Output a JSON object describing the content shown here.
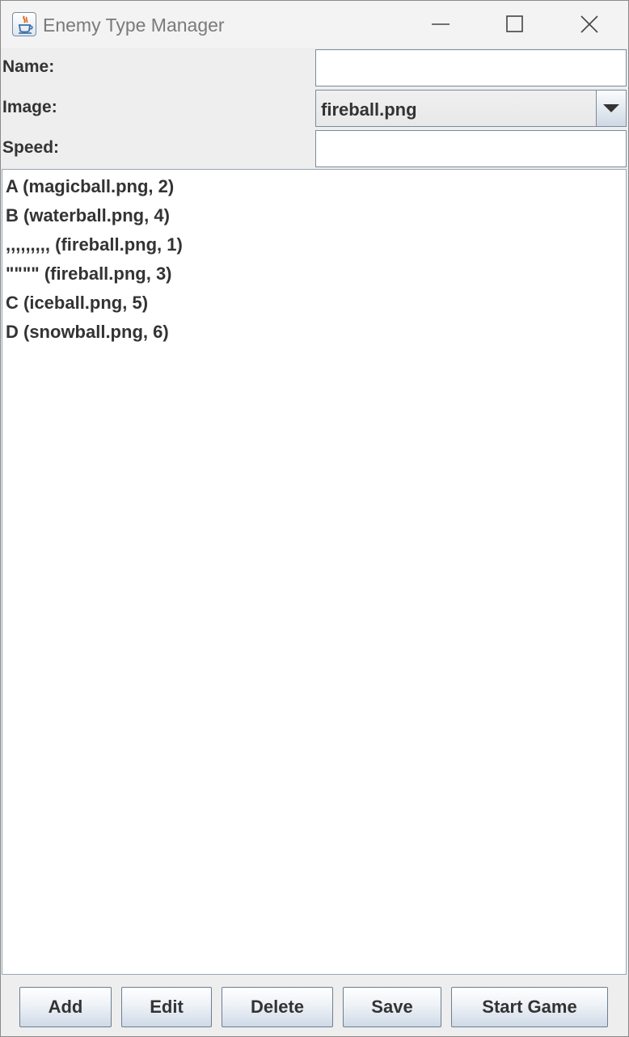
{
  "window": {
    "title": "Enemy Type Manager",
    "icon": "java-cup-icon"
  },
  "form": {
    "name_label": "Name:",
    "name_value": "",
    "image_label": "Image:",
    "image_selected": "fireball.png",
    "speed_label": "Speed:",
    "speed_value": ""
  },
  "enemy_list": [
    "A (magicball.png, 2)",
    "B (waterball.png, 4)",
    ",,,,,,,,, (fireball.png, 1)",
    "\"\"\"\" (fireball.png, 3)",
    "C (iceball.png, 5)",
    "D (snowball.png, 6)"
  ],
  "buttons": {
    "add": "Add",
    "edit": "Edit",
    "delete": "Delete",
    "save": "Save",
    "start_game": "Start Game"
  },
  "colors": {
    "button_border": "#6c7d91",
    "field_border": "#7a8a9e"
  }
}
